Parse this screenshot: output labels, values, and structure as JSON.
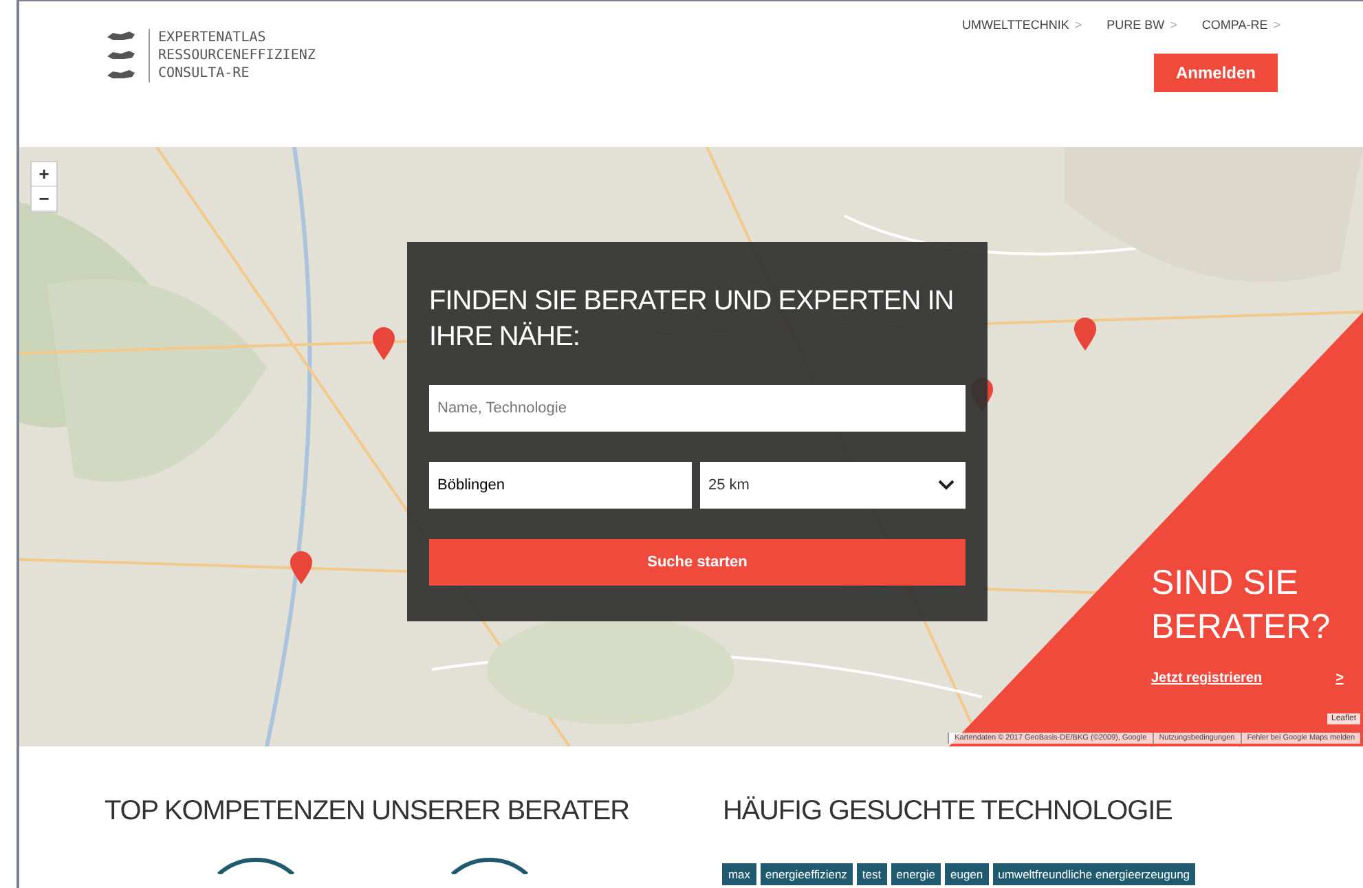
{
  "header": {
    "logo_lines": [
      "EXPERTENATLAS",
      "RESSOURCENEFFIZIENZ",
      "CONSULTA-RE"
    ],
    "nav": [
      {
        "label": "UMWELTTECHNIK",
        "arrow": ">"
      },
      {
        "label": "PURE BW",
        "arrow": ">"
      },
      {
        "label": "COMPA-RE",
        "arrow": ">"
      }
    ],
    "login_button": "Anmelden"
  },
  "map": {
    "zoom_in": "+",
    "zoom_out": "−",
    "attribution": [
      "Kartendaten © 2017 GeoBasis-DE/BKG (©2009), Google",
      "Nutzungsbedingungen",
      "Fehler bei Google Maps melden"
    ],
    "leaflet": "Leaflet"
  },
  "search": {
    "title": "FINDEN SIE BERATER UND EXPERTEN IN IHRE NÄHE:",
    "query": {
      "placeholder": "Name, Technologie"
    },
    "location": "Böblingen",
    "radius": "25 km",
    "submit": "Suche starten"
  },
  "promo": {
    "title": "SIND SIE BERATER?",
    "link": "Jetzt registrieren",
    "arrow": ">"
  },
  "competences": {
    "title": "TOP KOMPETENZEN UNSERER BERATER"
  },
  "technologies": {
    "title": "HÄUFIG GESUCHTE TECHNOLOGIE",
    "tags": [
      "max",
      "energieeffizienz",
      "test",
      "energie",
      "eugen",
      "umweltfreundliche energieerzeugung"
    ]
  }
}
